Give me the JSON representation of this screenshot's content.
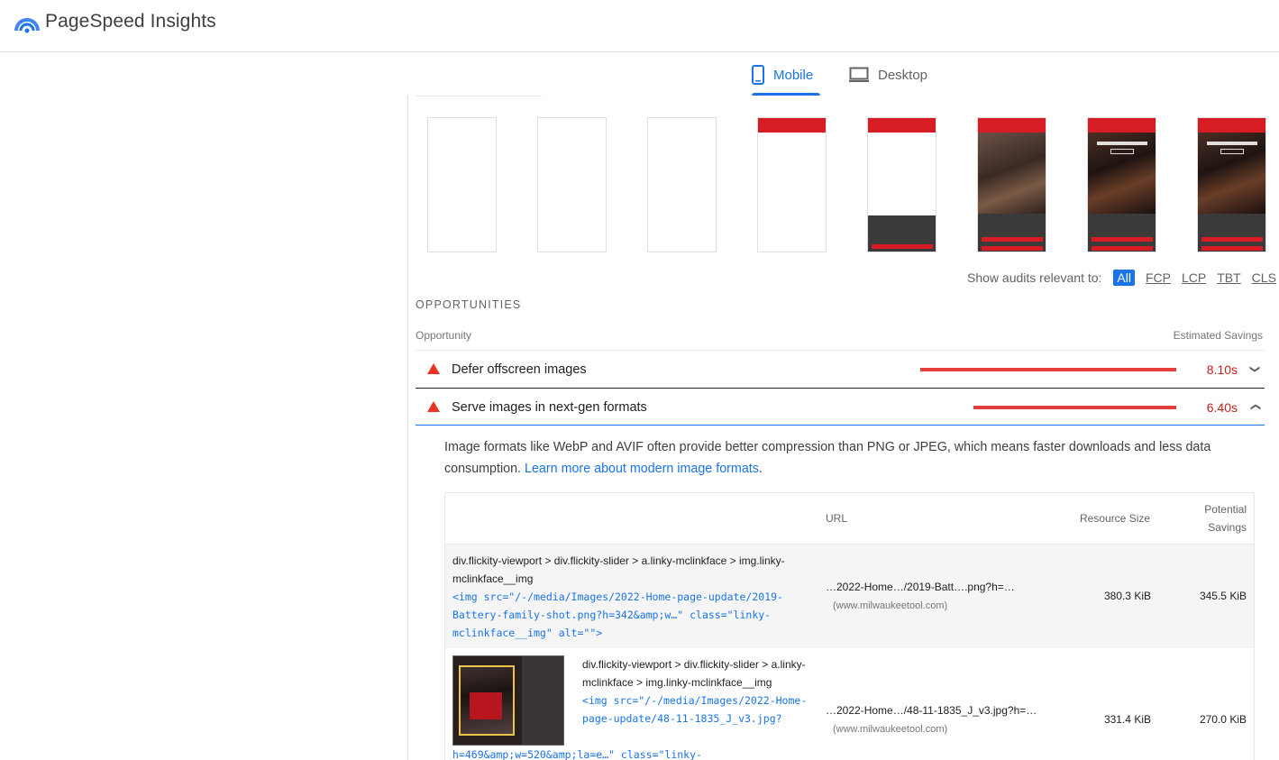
{
  "app": {
    "title": "PageSpeed Insights"
  },
  "tabs": {
    "mobile": "Mobile",
    "desktop": "Desktop"
  },
  "filmstrip": {
    "frame_count": 8
  },
  "filter": {
    "label": "Show audits relevant to:",
    "options": [
      "All",
      "FCP",
      "LCP",
      "TBT",
      "CLS"
    ],
    "selected": "All"
  },
  "opportunities": {
    "section_title": "OPPORTUNITIES",
    "col_opportunity": "Opportunity",
    "col_savings": "Estimated Savings",
    "items": [
      {
        "title": "Defer offscreen images",
        "value": "8.10s",
        "expanded": false
      },
      {
        "title": "Serve images in next-gen formats",
        "value": "6.40s",
        "expanded": true
      }
    ]
  },
  "details": {
    "description": "Image formats like WebP and AVIF often provide better compression than PNG or JPEG, which means faster downloads and less data consumption.",
    "learn_more": "Learn more about modern image formats",
    "learn_more_suffix": ".",
    "headers": {
      "url": "URL",
      "size": "Resource Size",
      "potential_line1": "Potential",
      "potential_line2": "Savings"
    },
    "rows": [
      {
        "path": "div.flickity-viewport > div.flickity-slider > a.linky-mclinkface > img.linky-mclinkface__img",
        "code": "<img src=\"/-/media/Images/2022-Home-page-update/2019-Battery-family-shot.png?h=342&amp;w…\" class=\"linky-mclinkface__img\" alt=\"\">",
        "url": "…2022-Home…/2019-Batt….png?h=…",
        "host": "(www.milwaukeetool.com)",
        "size": "380.3 KiB",
        "savings": "345.5 KiB"
      },
      {
        "path": "div.flickity-viewport > div.flickity-slider > a.linky-mclinkface > img.linky-mclinkface__img",
        "code": "<img src=\"/-/media/Images/2022-Home-page-update/48-11-1835_J_v3.jpg?",
        "code_cont": "h=469&amp;w=520&amp;la=e…\" class=\"linky-",
        "url": "…2022-Home…/48-11-1835_J_v3.jpg?h=…",
        "host": "(www.milwaukeetool.com)",
        "size": "331.4 KiB",
        "savings": "270.0 KiB"
      }
    ]
  },
  "colors": {
    "accent": "#1a73e8",
    "fail": "#eb3223",
    "fail_text": "#c5221f",
    "brand_red": "#d71c24"
  }
}
